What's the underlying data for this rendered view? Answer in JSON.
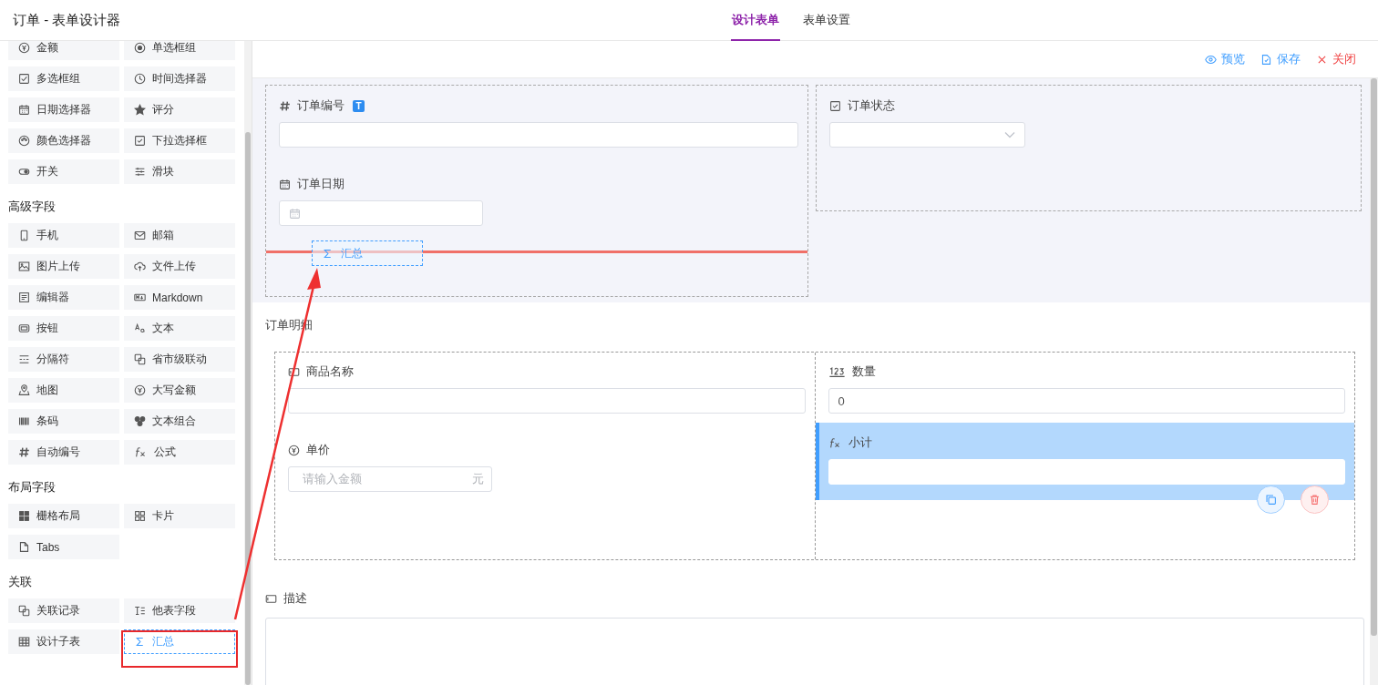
{
  "window": {
    "title": "订单 - 表单设计器"
  },
  "tabs": [
    {
      "label": "设计表单",
      "selected": true
    },
    {
      "label": "表单设置",
      "selected": false
    }
  ],
  "palette": {
    "sections": [
      {
        "items": [
          {
            "label": "金额",
            "kind": "money",
            "selected": false
          },
          {
            "label": "单选框组",
            "kind": "radio",
            "selected": false
          },
          {
            "label": "多选框组",
            "kind": "checkbox",
            "selected": false
          },
          {
            "label": "时间选择器",
            "kind": "clock",
            "selected": false
          },
          {
            "label": "日期选择器",
            "kind": "calendar",
            "selected": false
          },
          {
            "label": "评分",
            "kind": "star",
            "selected": false
          },
          {
            "label": "颜色选择器",
            "kind": "palette",
            "selected": false
          },
          {
            "label": "下拉选择框",
            "kind": "select",
            "selected": false
          },
          {
            "label": "开关",
            "kind": "switch",
            "selected": false
          },
          {
            "label": "滑块",
            "kind": "slider",
            "selected": false
          }
        ]
      },
      {
        "title": "高级字段",
        "items": [
          {
            "label": "手机",
            "kind": "phone",
            "selected": false
          },
          {
            "label": "邮箱",
            "kind": "mail",
            "selected": false
          },
          {
            "label": "图片上传",
            "kind": "image",
            "selected": false
          },
          {
            "label": "文件上传",
            "kind": "upload",
            "selected": false
          },
          {
            "label": "编辑器",
            "kind": "editor",
            "selected": false
          },
          {
            "label": "Markdown",
            "kind": "markdown",
            "selected": false
          },
          {
            "label": "按钮",
            "kind": "button",
            "selected": false
          },
          {
            "label": "文本",
            "kind": "text",
            "selected": false
          },
          {
            "label": "分隔符",
            "kind": "divider",
            "selected": false
          },
          {
            "label": "省市级联动",
            "kind": "cascade",
            "selected": false
          },
          {
            "label": "地图",
            "kind": "map",
            "selected": false
          },
          {
            "label": "大写金额",
            "kind": "money",
            "selected": false
          },
          {
            "label": "条码",
            "kind": "barcode",
            "selected": false
          },
          {
            "label": "文本组合",
            "kind": "group",
            "selected": false
          },
          {
            "label": "自动编号",
            "kind": "hash",
            "selected": false
          },
          {
            "label": "公式",
            "kind": "fx",
            "selected": false
          }
        ]
      },
      {
        "title": "布局字段",
        "items": [
          {
            "label": "栅格布局",
            "kind": "grid",
            "selected": false
          },
          {
            "label": "卡片",
            "kind": "card",
            "selected": false
          },
          {
            "label": "Tabs",
            "kind": "tabs",
            "selected": false
          }
        ]
      },
      {
        "title": "关联",
        "items": [
          {
            "label": "关联记录",
            "kind": "cascade",
            "selected": false
          },
          {
            "label": "他表字段",
            "kind": "lookup",
            "selected": false
          },
          {
            "label": "设计子表",
            "kind": "table",
            "selected": false
          },
          {
            "label": "汇总",
            "kind": "sigma",
            "selected": true
          }
        ]
      }
    ]
  },
  "toolbar": [
    {
      "label": "预览",
      "kind": "preview"
    },
    {
      "label": "保存",
      "kind": "save"
    },
    {
      "label": "关闭",
      "kind": "close"
    }
  ],
  "form": {
    "grid": [
      {
        "fields": [
          {
            "label": "订单编号",
            "kind": "serial",
            "badge": "T",
            "selected": false
          },
          {
            "label": "订单日期",
            "kind": "date",
            "selected": false
          }
        ]
      },
      {
        "fields": [
          {
            "label": "订单状态",
            "kind": "select",
            "selected": false
          }
        ]
      }
    ],
    "drop_ghost": {
      "label": "汇总",
      "kind": "sigma"
    },
    "subtable": {
      "title": "订单明细",
      "columns": [
        {
          "fields": [
            {
              "label": "商品名称",
              "kind": "input",
              "selected": false
            },
            {
              "label": "单价",
              "kind": "money",
              "placeholder": "请输入金额",
              "suffix": "元",
              "selected": false
            }
          ]
        },
        {
          "fields": [
            {
              "label": "数量",
              "kind": "number",
              "value": "0",
              "selected": false
            },
            {
              "label": "小计",
              "kind": "formula",
              "selected": true
            }
          ]
        }
      ]
    },
    "description": {
      "label": "描述",
      "kind": "textarea"
    }
  }
}
